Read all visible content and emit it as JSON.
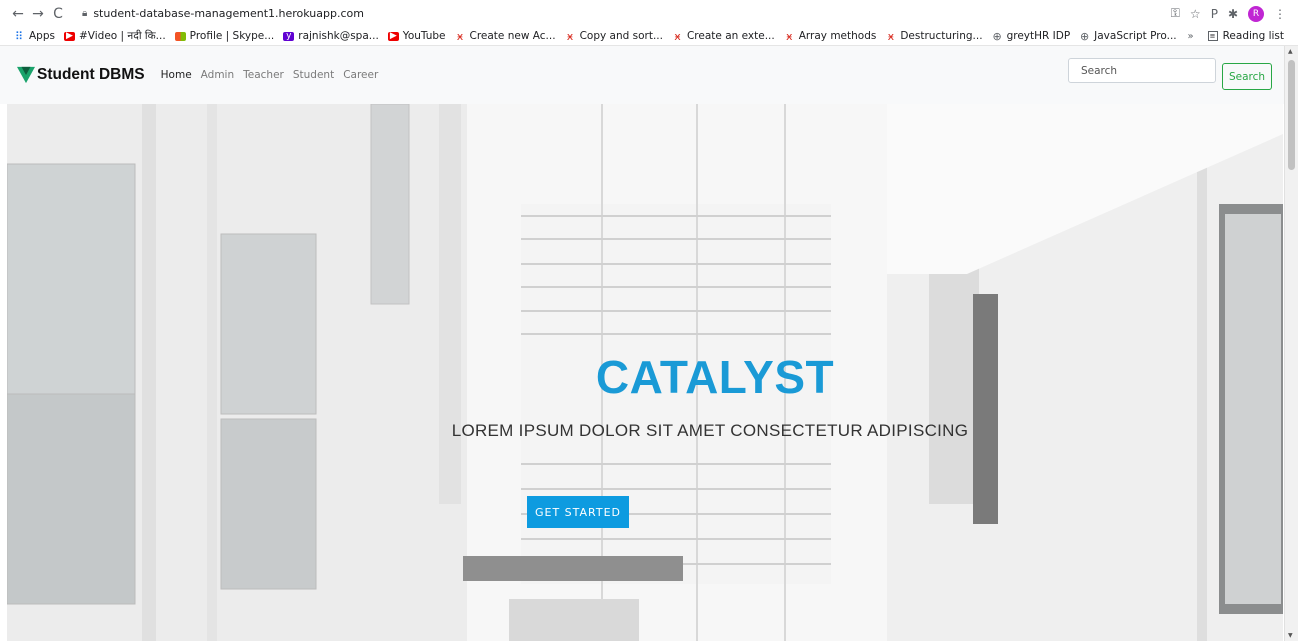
{
  "browser": {
    "url": "student-database-management1.herokuapp.com",
    "bookmarks": [
      {
        "icon": "apps-icon",
        "label": "Apps"
      },
      {
        "icon": "youtube-icon",
        "label": "#Video | नदी कि..."
      },
      {
        "icon": "microsoft-icon",
        "label": "Profile | Skype..."
      },
      {
        "icon": "yahoo-icon",
        "label": "rajnishk@spa..."
      },
      {
        "icon": "youtube-icon",
        "label": "YouTube"
      },
      {
        "icon": "codewars-icon",
        "label": "Create new Ac..."
      },
      {
        "icon": "codewars-icon",
        "label": "Copy and sort..."
      },
      {
        "icon": "codewars-icon",
        "label": "Create an exte..."
      },
      {
        "icon": "codewars-icon",
        "label": "Array methods"
      },
      {
        "icon": "codewars-icon",
        "label": "Destructuring..."
      },
      {
        "icon": "globe-icon",
        "label": "greytHR IDP"
      },
      {
        "icon": "globe-icon",
        "label": "JavaScript Pro..."
      }
    ],
    "reading_list": "Reading list",
    "profile_initial": "R"
  },
  "nav": {
    "brand": "Student DBMS",
    "links": [
      "Home",
      "Admin",
      "Teacher",
      "Student",
      "Career"
    ],
    "search_placeholder": "Search",
    "search_button": "Search"
  },
  "hero": {
    "title": "CATALYST",
    "subtitle": "LOREM IPSUM DOLOR SIT AMET CONSECTETUR ADIPISCING",
    "button": "GET STARTED"
  },
  "colors": {
    "accent": "#1a9ad6",
    "button": "#0d9be0",
    "logo": "#1aa36b",
    "search_button": "#28a745"
  }
}
